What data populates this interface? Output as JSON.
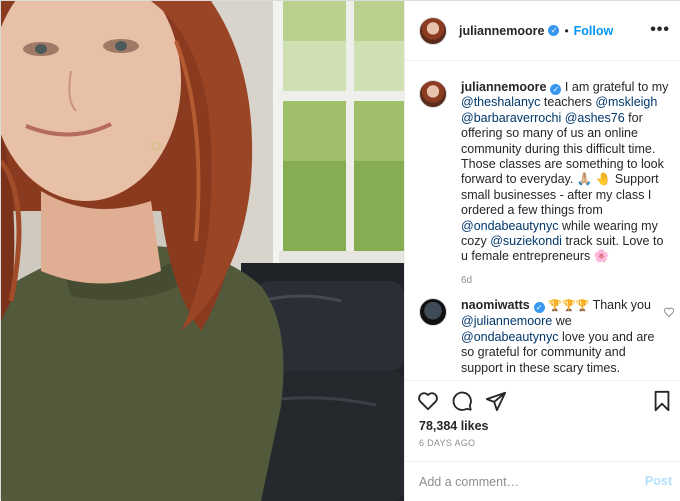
{
  "header": {
    "username": "juliannemoore",
    "separator": "•",
    "follow_label": "Follow",
    "more_label": "•••"
  },
  "caption": {
    "username": "juliannemoore",
    "t1": "I am grateful to my",
    "m1": "@theshalanyc",
    "t2": "teachers",
    "m2": "@mskleigh",
    "m3": "@barbaraverrochi",
    "m4": "@ashes76",
    "t3": "for offering so many of us an online community during this difficult time. Those classes are something to look forward to everyday. 🙏🏼 🤚 Support small businesses - after my class I ordered a few things from",
    "m5": "@ondabeautynyc",
    "t4": "while wearing my cozy",
    "m6": "@suziekondi",
    "t5": "track suit. Love to u female entrepreneurs 🌸",
    "time": "6d"
  },
  "comment": {
    "username": "naomiwatts",
    "emojis": "🏆🏆🏆",
    "t1": "Thank you",
    "m1": "@juliannemoore",
    "t2": "we",
    "m2": "@ondabeautynyc",
    "t3": "love you and are so grateful for community and support in these scary times."
  },
  "stats": {
    "likes": "78,384 likes",
    "date": "6 DAYS AGO"
  },
  "compose": {
    "placeholder": "Add a comment…",
    "post_label": "Post"
  },
  "icons": {
    "like": "heart-icon",
    "comment": "comment-icon",
    "share": "share-icon",
    "save": "bookmark-icon",
    "verified": "verified-badge-icon",
    "more": "more-options-icon"
  },
  "colors": {
    "accent": "#0095f6",
    "verified": "#3897f0",
    "mention": "#00376b",
    "muted": "#8e8e8e",
    "post_disabled": "#b2dffc"
  }
}
